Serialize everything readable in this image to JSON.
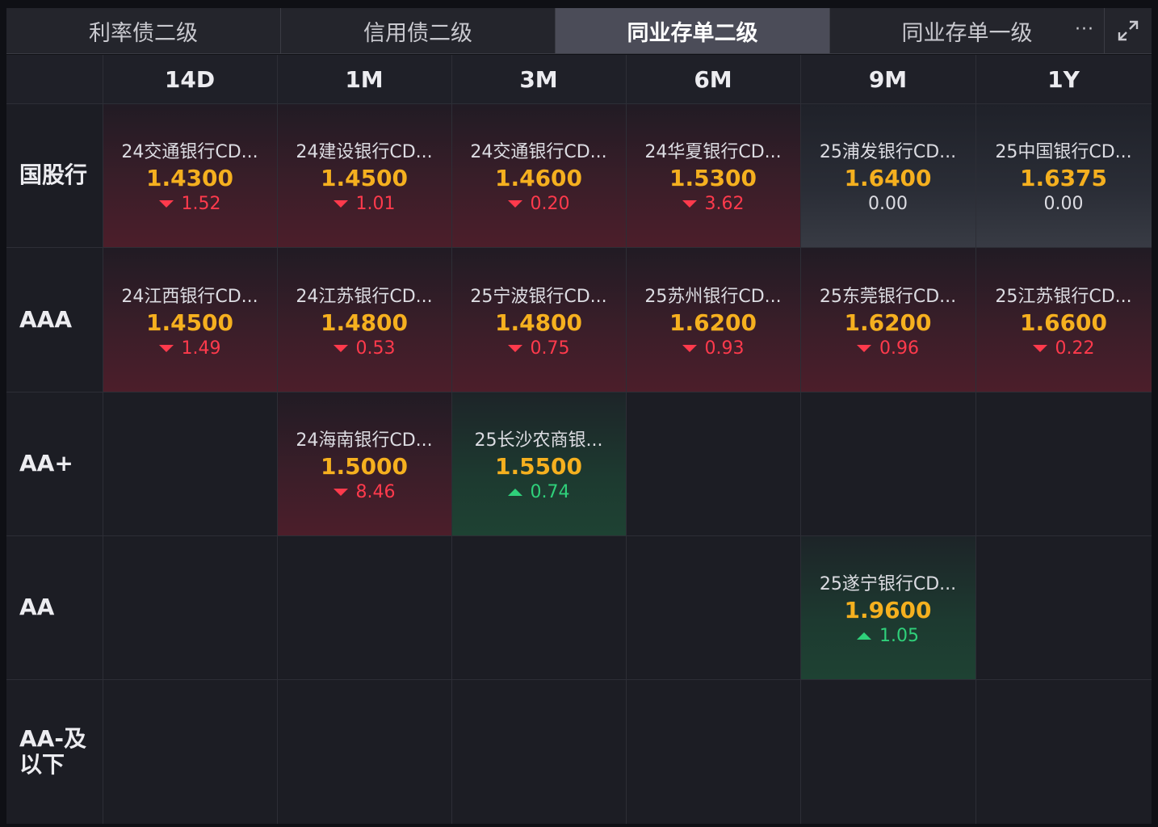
{
  "tabs": [
    {
      "label": "利率债二级"
    },
    {
      "label": "信用债二级"
    },
    {
      "label": "同业存单二级"
    },
    {
      "label": "同业存单一级"
    }
  ],
  "more_label": "···",
  "columns": [
    "14D",
    "1M",
    "3M",
    "6M",
    "9M",
    "1Y"
  ],
  "rows": [
    "国股行",
    "AAA",
    "AA+",
    "AA",
    "AA-及以下"
  ],
  "cells": {
    "r0": [
      {
        "name": "24交通银行CD...",
        "rate": "1.4300",
        "change": "1.52",
        "dir": "down"
      },
      {
        "name": "24建设银行CD...",
        "rate": "1.4500",
        "change": "1.01",
        "dir": "down"
      },
      {
        "name": "24交通银行CD...",
        "rate": "1.4600",
        "change": "0.20",
        "dir": "down"
      },
      {
        "name": "24华夏银行CD...",
        "rate": "1.5300",
        "change": "3.62",
        "dir": "down"
      },
      {
        "name": "25浦发银行CD...",
        "rate": "1.6400",
        "change": "0.00",
        "dir": "flat"
      },
      {
        "name": "25中国银行CD...",
        "rate": "1.6375",
        "change": "0.00",
        "dir": "flat"
      }
    ],
    "r1": [
      {
        "name": "24江西银行CD...",
        "rate": "1.4500",
        "change": "1.49",
        "dir": "down"
      },
      {
        "name": "24江苏银行CD...",
        "rate": "1.4800",
        "change": "0.53",
        "dir": "down"
      },
      {
        "name": "25宁波银行CD...",
        "rate": "1.4800",
        "change": "0.75",
        "dir": "down"
      },
      {
        "name": "25苏州银行CD...",
        "rate": "1.6200",
        "change": "0.93",
        "dir": "down"
      },
      {
        "name": "25东莞银行CD...",
        "rate": "1.6200",
        "change": "0.96",
        "dir": "down"
      },
      {
        "name": "25江苏银行CD...",
        "rate": "1.6600",
        "change": "0.22",
        "dir": "down"
      }
    ],
    "r2": [
      null,
      {
        "name": "24海南银行CD...",
        "rate": "1.5000",
        "change": "8.46",
        "dir": "down"
      },
      {
        "name": "25长沙农商银...",
        "rate": "1.5500",
        "change": "0.74",
        "dir": "up"
      },
      null,
      null,
      null
    ],
    "r3": [
      null,
      null,
      null,
      null,
      {
        "name": "25遂宁银行CD...",
        "rate": "1.9600",
        "change": "1.05",
        "dir": "up"
      },
      null
    ],
    "r4": [
      null,
      null,
      null,
      null,
      null,
      null
    ]
  },
  "colors": {
    "rate": "#f5b01f",
    "down": "#ff3a4c",
    "up": "#2fd07a",
    "background": "#1c1d24"
  }
}
